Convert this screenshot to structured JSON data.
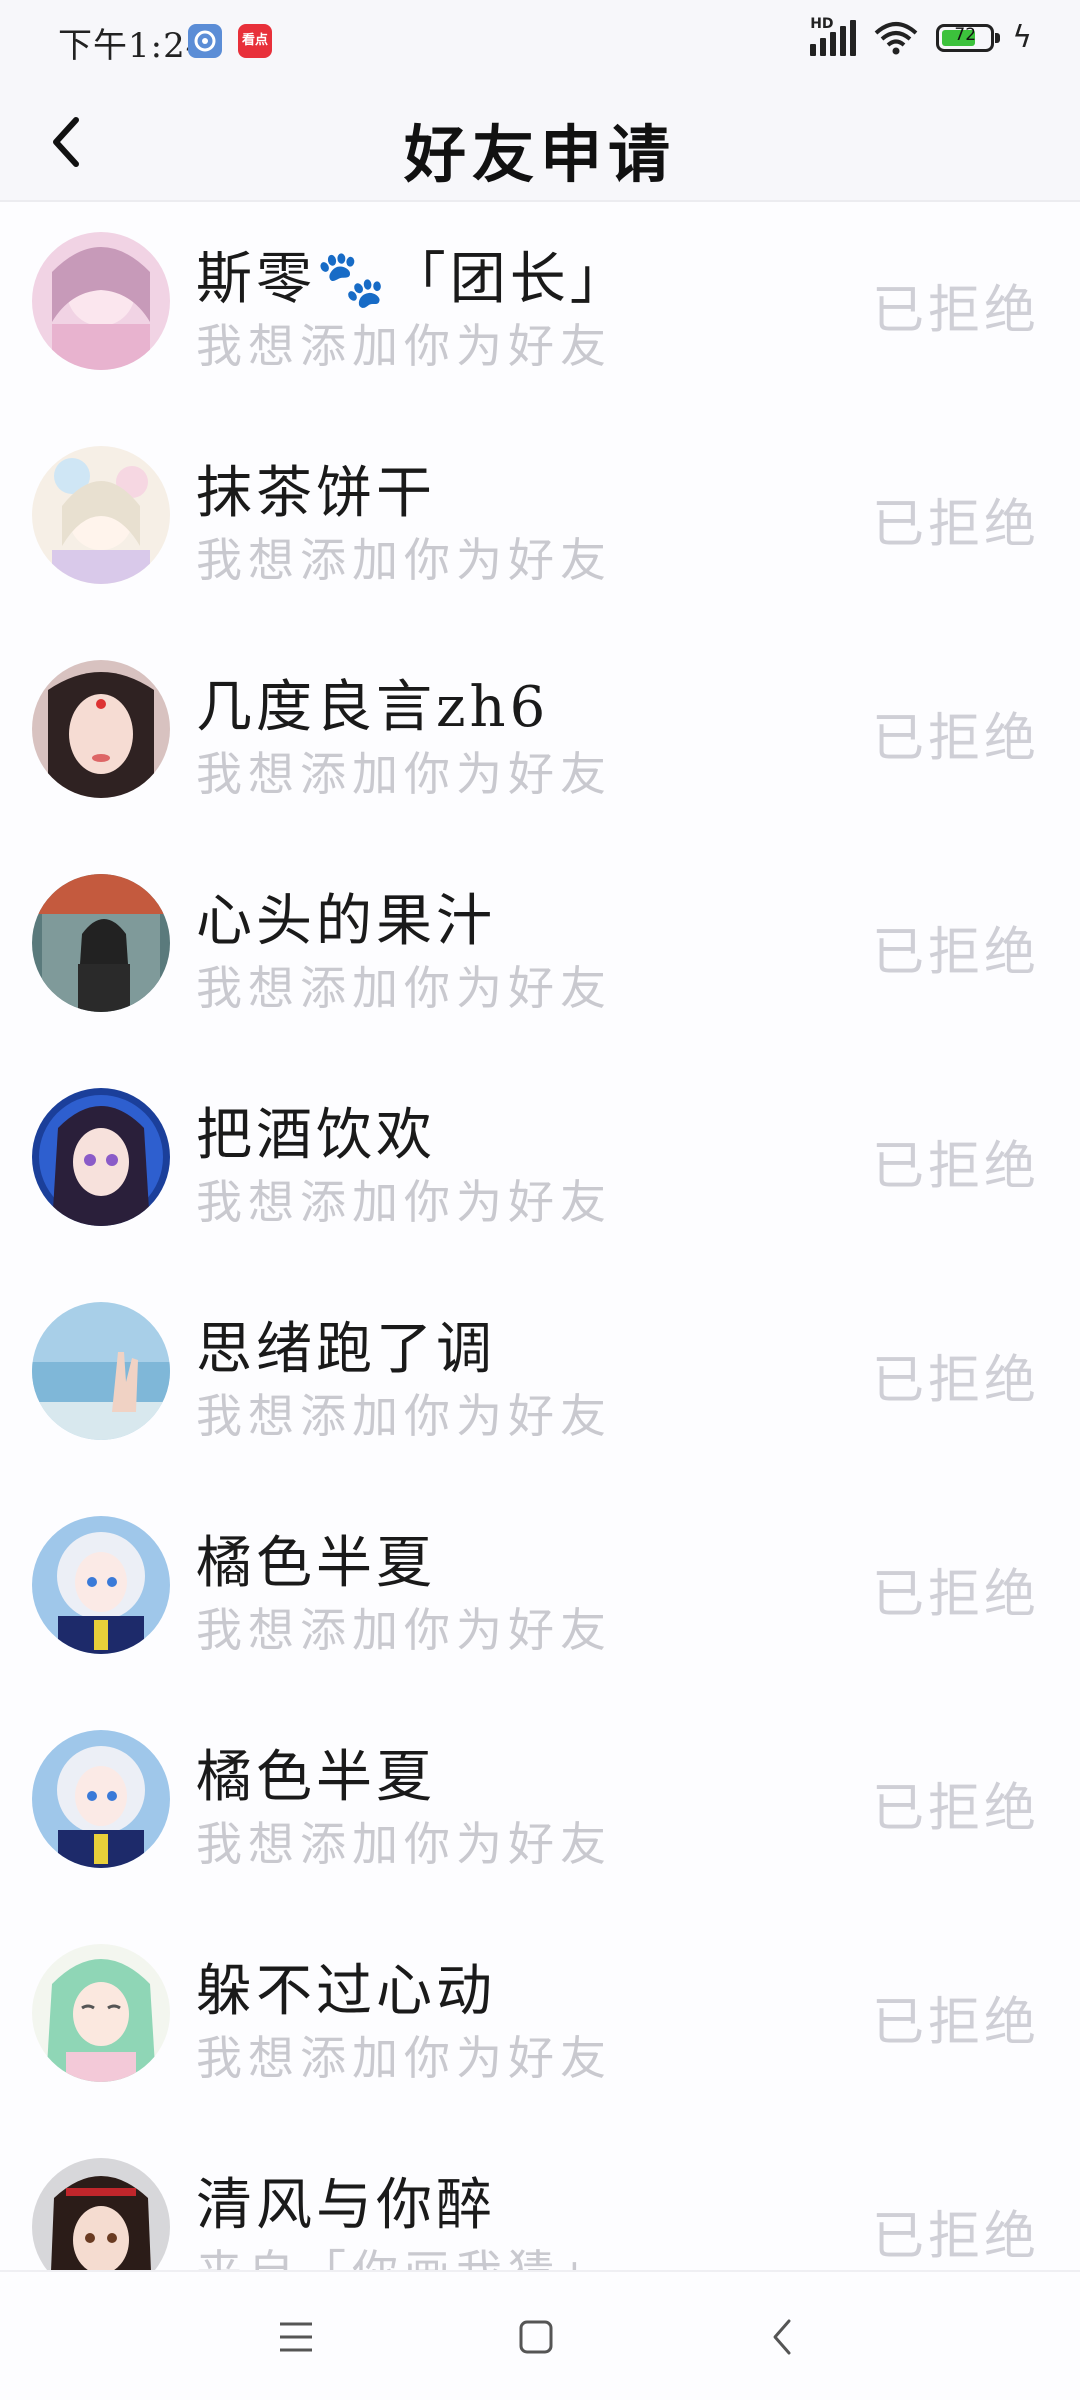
{
  "status_bar": {
    "time": "下午1:24",
    "news_badge": "看点",
    "network": "HD",
    "battery_level": "72",
    "battery_fill": 0.72
  },
  "header": {
    "title": "好友申请"
  },
  "requests": [
    {
      "name": "斯零🐾「团长」",
      "message": "我想添加你为好友",
      "status": "已拒绝",
      "avatar": "pink-anime-girl"
    },
    {
      "name": "抹茶饼干",
      "message": "我想添加你为好友",
      "status": "已拒绝",
      "avatar": "pastel-anime-girl"
    },
    {
      "name": "几度良言zh6",
      "message": "我想添加你为好友",
      "status": "已拒绝",
      "avatar": "selfie-girl"
    },
    {
      "name": "心头的果汁",
      "message": "我想添加你为好友",
      "status": "已拒绝",
      "avatar": "girl-outdoor-photo"
    },
    {
      "name": "把酒饮欢",
      "message": "我想添加你为好友",
      "status": "已拒绝",
      "avatar": "blue-anime-girl"
    },
    {
      "name": "思绪跑了调",
      "message": "我想添加你为好友",
      "status": "已拒绝",
      "avatar": "sea-hand-photo"
    },
    {
      "name": "橘色半夏",
      "message": "我想添加你为好友",
      "status": "已拒绝",
      "avatar": "white-hair-anime"
    },
    {
      "name": "橘色半夏",
      "message": "我想添加你为好友",
      "status": "已拒绝",
      "avatar": "white-hair-anime"
    },
    {
      "name": "躲不过心动",
      "message": "我想添加你为好友",
      "status": "已拒绝",
      "avatar": "green-hair-anime"
    },
    {
      "name": "清风与你醉",
      "message": "来自「你画我猜」",
      "status": "已拒绝",
      "avatar": "dark-hair-anime"
    }
  ],
  "colors": {
    "title": "#111111",
    "name": "#1a1a1a",
    "secondary": "#c9c9cf",
    "status": "#cfcfd6",
    "battery": "#3cc23c"
  },
  "icons": {
    "back": "chevron-left-icon",
    "menu": "menu-icon",
    "home": "square-home-icon",
    "nav_back": "nav-back-icon"
  }
}
